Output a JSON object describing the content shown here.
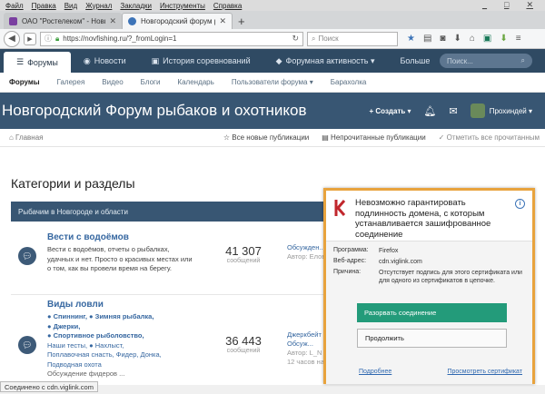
{
  "menu": [
    "Файл",
    "Правка",
    "Вид",
    "Журнал",
    "Закладки",
    "Инструменты",
    "Справка"
  ],
  "window_controls": [
    "_",
    "□",
    "✕"
  ],
  "tabs": [
    {
      "title": "ОАО \"Ростелеком\" - Новгор...",
      "close": "✕"
    },
    {
      "title": "Новгородский форум рыбак...",
      "close": "✕"
    }
  ],
  "new_tab": "+",
  "nav": {
    "back": "◀",
    "forward": "▶",
    "url": "https://novfishing.ru/?_fromLogin=1",
    "search_placeholder": "Поиск"
  },
  "site_nav": {
    "tabs": [
      {
        "icon": "☰",
        "label": "Форумы"
      },
      {
        "icon": "◉",
        "label": "Новости"
      },
      {
        "icon": "▣",
        "label": "История соревнований"
      },
      {
        "icon": "◆",
        "label": "Форумная активность ▾"
      },
      {
        "icon": "",
        "label": "Больше"
      }
    ],
    "search_placeholder": "Поиск..."
  },
  "sub_nav": [
    "Форумы",
    "Галерея",
    "Видео",
    "Блоги",
    "Календарь",
    "Пользователи форума ▾",
    "Барахолка"
  ],
  "header": {
    "title": "Новгородский Форум рыбаков и охотников",
    "create": "+ Создать ▾",
    "user": "Прохиндей ▾"
  },
  "breadcrumbs": {
    "home": "⌂ Главная",
    "links": [
      "Все новые публикации",
      "Непрочитанные публикации",
      "Отметить все прочитанным"
    ]
  },
  "content": {
    "page_title": "Категории и разделы",
    "section_title": "Рыбачим в Новгороде и области",
    "forums": [
      {
        "title": "Вести с водоёмов",
        "desc": "Вести с водоёмов, отчеты о рыбалках, удачных и нет. Просто о красивых местах или о том, как вы провели время на берегу.",
        "count": "41 307",
        "count_label": "сообщений",
        "last": "Обсужден...",
        "author": "Автор: Елов..."
      },
      {
        "title": "Виды ловли",
        "subs": [
          "● Спиннинг, ● Зимняя рыбалка,",
          "● Джерки, ",
          "● Спортивное рыболовство,",
          "Наши тесты, ● Нахлыст,",
          "Поплавочная снасть, Фидер, Донка,",
          "Подводная охота",
          "Обсуждение фидеров ..."
        ],
        "count": "36 443",
        "count_label": "сообщений",
        "last": "Джеркбейт ...",
        "last2": "Обсуж...",
        "author": "Автор: L_N",
        "date": "12 часов назад"
      }
    ]
  },
  "status_text": "Соединено с cdn.viglink.com",
  "kav": {
    "title": "Невозможно гарантировать подлинность домена, с которым устанавливается зашифрованное соединение",
    "info": "i",
    "rows": [
      {
        "k": "Программа:",
        "v": "Firefox"
      },
      {
        "k": "Веб-адрес:",
        "v": "cdn.viglink.com"
      },
      {
        "k": "Причина:",
        "v": "Отсутствует подпись для этого сертификата или для одного из сертификатов в цепочке."
      }
    ],
    "btn_primary": "Разорвать соединение",
    "btn_secondary": "Продолжить",
    "link_more": "Подробнее",
    "link_cert": "Просмотреть сертификат"
  },
  "colors": {
    "site_nav_bg": "#2f4a63",
    "header_bg": "#385673",
    "kav_border": "#e8a33d",
    "kav_primary": "#239b7a"
  }
}
